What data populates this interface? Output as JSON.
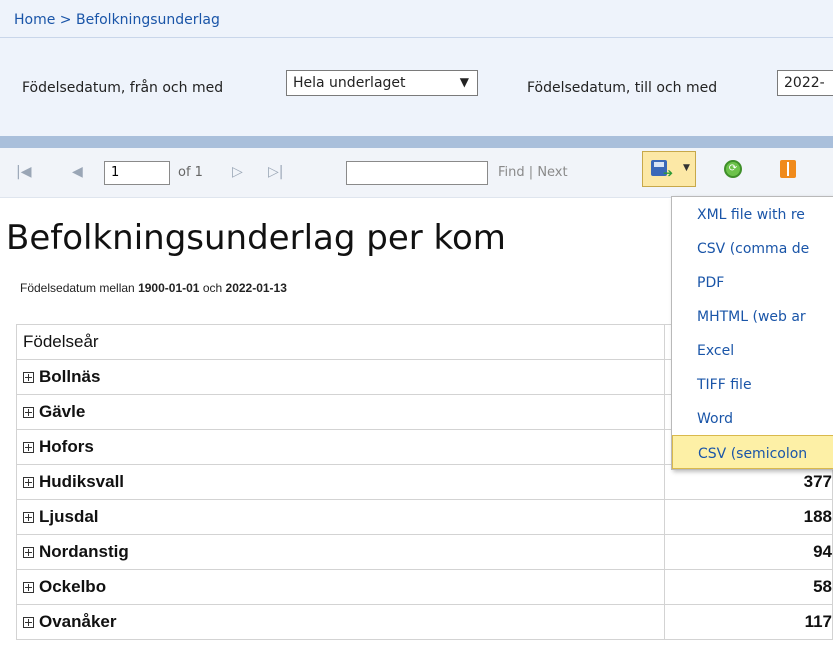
{
  "breadcrumb": "Home > Befolkningsunderlag",
  "params": {
    "from_label": "Födelsedatum, från och med",
    "from_value": "Hela underlaget",
    "to_label": "Födelsedatum, till och med",
    "to_value": "2022-"
  },
  "toolbar": {
    "page_value": "1",
    "of_text": "of 1",
    "find_label": "Find",
    "separator": "|",
    "next_label": "Next",
    "refresh_glyph": "⟳"
  },
  "report": {
    "title": "Befolkningsunderlag per kom",
    "subtitle_prefix": "Födelsedatum mellan",
    "date_from": "1900-01-01",
    "subtitle_mid": "och",
    "date_to": "2022-01-13",
    "header_col1": "Födelseår",
    "rows": [
      {
        "name": "Bollnäs",
        "value": ""
      },
      {
        "name": "Gävle",
        "value": ""
      },
      {
        "name": "Hofors",
        "value": ""
      },
      {
        "name": "Hudiksvall",
        "value": "377"
      },
      {
        "name": "Ljusdal",
        "value": "188"
      },
      {
        "name": "Nordanstig",
        "value": "94"
      },
      {
        "name": "Ockelbo",
        "value": "58"
      },
      {
        "name": "Ovanåker",
        "value": "117"
      }
    ]
  },
  "export_menu": {
    "items": [
      "XML file with re",
      "CSV (comma de",
      "PDF",
      "MHTML (web ar",
      "Excel",
      "TIFF file",
      "Word",
      "CSV (semicolon"
    ],
    "highlighted_index": 7
  },
  "icons": {
    "first_page": "first-page-icon",
    "prev_page": "previous-page-icon",
    "next_page": "next-page-icon",
    "last_page": "last-page-icon",
    "export": "save-export-icon",
    "refresh": "refresh-icon",
    "document_map": "document-map-icon"
  },
  "colors": {
    "link": "#1a55a8",
    "header_bg": "#eef3fb",
    "separator_bar": "#a9bfdb",
    "highlight": "#fdf0a6"
  }
}
